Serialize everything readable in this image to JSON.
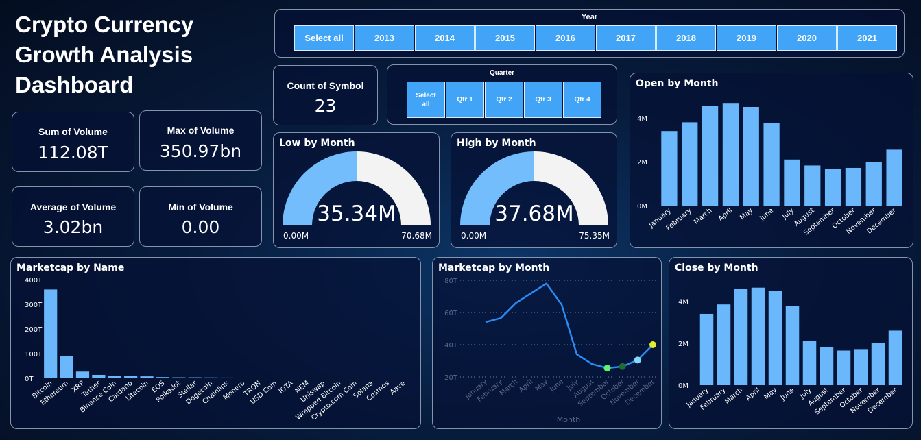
{
  "page": {
    "title": "Crypto Currency Growth Analysis Dashboard"
  },
  "kpis": [
    {
      "label": "Sum of Volume",
      "value": "112.08T"
    },
    {
      "label": "Max of Volume",
      "value": "350.97bn"
    },
    {
      "label": "Average of Volume",
      "value": "3.02bn"
    },
    {
      "label": "Min of Volume",
      "value": "0.00"
    },
    {
      "label": "Count of Symbol",
      "value": "23"
    }
  ],
  "year_slicer": {
    "title": "Year",
    "options": [
      "Select all",
      "2013",
      "2014",
      "2015",
      "2016",
      "2017",
      "2018",
      "2019",
      "2020",
      "2021"
    ]
  },
  "quarter_slicer": {
    "title": "Quarter",
    "options": [
      "Select all",
      "Qtr 1",
      "Qtr 2",
      "Qtr 3",
      "Qtr 4"
    ]
  },
  "gauges": {
    "low": {
      "title": "Low by Month",
      "value_label": "35.34M",
      "min_label": "0.00M",
      "max_label": "70.68M",
      "fraction": 0.5,
      "fill_color": "#74bdfc",
      "track_color": "#f3f3f3"
    },
    "high": {
      "title": "High by Month",
      "value_label": "37.68M",
      "min_label": "0.00M",
      "max_label": "75.35M",
      "fraction": 0.5,
      "fill_color": "#74bdfc",
      "track_color": "#f3f3f3"
    }
  },
  "colors": {
    "bar": "#6ab8fb",
    "line": "#2a8cf5",
    "grid": "#6b7fa8",
    "muted_text": "#5a6a86"
  },
  "chart_data": [
    {
      "id": "open",
      "type": "bar",
      "title": "Open by Month",
      "categories": [
        "January",
        "February",
        "March",
        "April",
        "May",
        "June",
        "July",
        "August",
        "September",
        "October",
        "November",
        "December"
      ],
      "values": [
        3.4,
        3.8,
        4.55,
        4.65,
        4.5,
        3.78,
        2.1,
        1.83,
        1.67,
        1.72,
        2.0,
        2.55
      ],
      "ylim": [
        0,
        5
      ],
      "yticks": [
        0,
        2,
        4
      ],
      "ytick_labels": [
        "0M",
        "2M",
        "4M"
      ]
    },
    {
      "id": "close",
      "type": "bar",
      "title": "Close by Month",
      "categories": [
        "January",
        "February",
        "March",
        "April",
        "May",
        "June",
        "July",
        "August",
        "September",
        "October",
        "November",
        "December"
      ],
      "values": [
        3.4,
        3.85,
        4.6,
        4.65,
        4.5,
        3.78,
        2.12,
        1.82,
        1.65,
        1.72,
        2.02,
        2.6
      ],
      "ylim": [
        0,
        5
      ],
      "yticks": [
        0,
        2,
        4
      ],
      "ytick_labels": [
        "0M",
        "2M",
        "4M"
      ]
    },
    {
      "id": "marketcap_name",
      "type": "bar",
      "title": "Marketcap by Name",
      "categories": [
        "Bitcoin",
        "Ethereum",
        "XRP",
        "Tether",
        "Binance Coin",
        "Cardano",
        "Litecoin",
        "EOS",
        "Polkadot",
        "Stellar",
        "Dogecoin",
        "Chainlink",
        "Monero",
        "TRON",
        "USD Coin",
        "IOTA",
        "NEM",
        "Uniswap",
        "Wrapped Bitcoin",
        "Crypto.com Coin",
        "Solana",
        "Cosmos",
        "Aave"
      ],
      "values": [
        360,
        90,
        27,
        14,
        10,
        9,
        8,
        5,
        4,
        4,
        3.5,
        3,
        2.5,
        2,
        2,
        1.5,
        1.5,
        1.2,
        1.2,
        1,
        1,
        0.8,
        0.8
      ],
      "ylim": [
        0,
        400
      ],
      "yticks": [
        0,
        100,
        200,
        300,
        400
      ],
      "ytick_labels": [
        "0T",
        "100T",
        "200T",
        "300T",
        "400T"
      ]
    },
    {
      "id": "marketcap_month",
      "type": "line",
      "title": "Marketcap by Month",
      "xlabel": "Month",
      "categories": [
        "January",
        "February",
        "March",
        "April",
        "May",
        "June",
        "July",
        "August",
        "September",
        "October",
        "November",
        "December"
      ],
      "values": [
        54,
        56.5,
        66,
        72,
        78,
        65,
        34,
        28,
        25.5,
        26.5,
        30.5,
        40
      ],
      "ylim": [
        20,
        80
      ],
      "yticks": [
        20,
        40,
        60,
        80
      ],
      "ytick_labels": [
        "20T",
        "40T",
        "60T",
        "80T"
      ],
      "highlight_points": [
        {
          "category": "September",
          "color": "#5cf56e"
        },
        {
          "category": "October",
          "color": "#1f6b32"
        },
        {
          "category": "November",
          "color": "#86d8fb"
        },
        {
          "category": "December",
          "color": "#e5ec2c"
        }
      ]
    }
  ]
}
